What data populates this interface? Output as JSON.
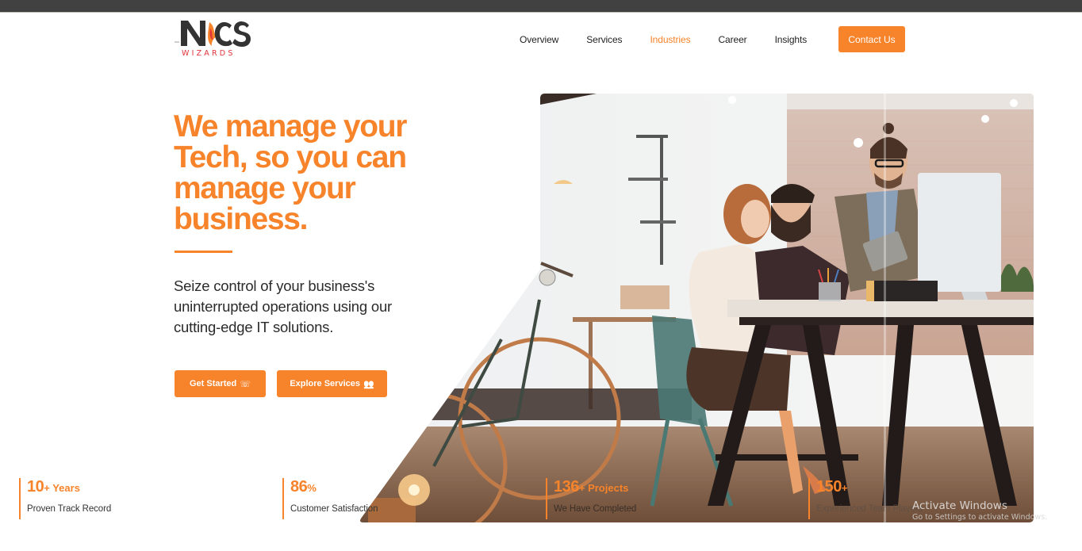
{
  "browser": {
    "top_bar_color": "#414141"
  },
  "brand": {
    "logo_text": "NCS",
    "logo_subtext": "WIZARDS",
    "primary_color": "#F7832A",
    "logo_dark_color": "#333333",
    "logo_red_color": "#E2343A"
  },
  "nav": {
    "items": [
      {
        "label": "Overview",
        "active": false
      },
      {
        "label": "Services",
        "active": false
      },
      {
        "label": "Industries",
        "active": true
      },
      {
        "label": "Career",
        "active": false
      },
      {
        "label": "Insights",
        "active": false
      }
    ],
    "cta_label": "Contact Us"
  },
  "hero": {
    "title": "We manage your Tech, so you can manage your business.",
    "subtitle": "Seize control of your business's uninterrupted operations using our cutting-edge IT solutions.",
    "buttons": [
      {
        "label": "Get Started",
        "icon": "phone-icon",
        "glyph": "☏"
      },
      {
        "label": "Explore Services",
        "icon": "users-icon",
        "glyph": "👥"
      }
    ],
    "image_alt": "Team of professionals working together at a desk in a modern office"
  },
  "stats": [
    {
      "value": "10",
      "suffix": "+ Years",
      "label": "Proven Track Record"
    },
    {
      "value": "86",
      "suffix": "%",
      "label": "Customer Satisfaction"
    },
    {
      "value": "136",
      "suffix": "+ Projects",
      "label": "We Have Completed"
    },
    {
      "value": "150",
      "suffix": "+",
      "label": "Experienced Team Players"
    }
  ],
  "os_watermark": {
    "title": "Activate Windows",
    "subtitle": "Go to Settings to activate Windows."
  }
}
